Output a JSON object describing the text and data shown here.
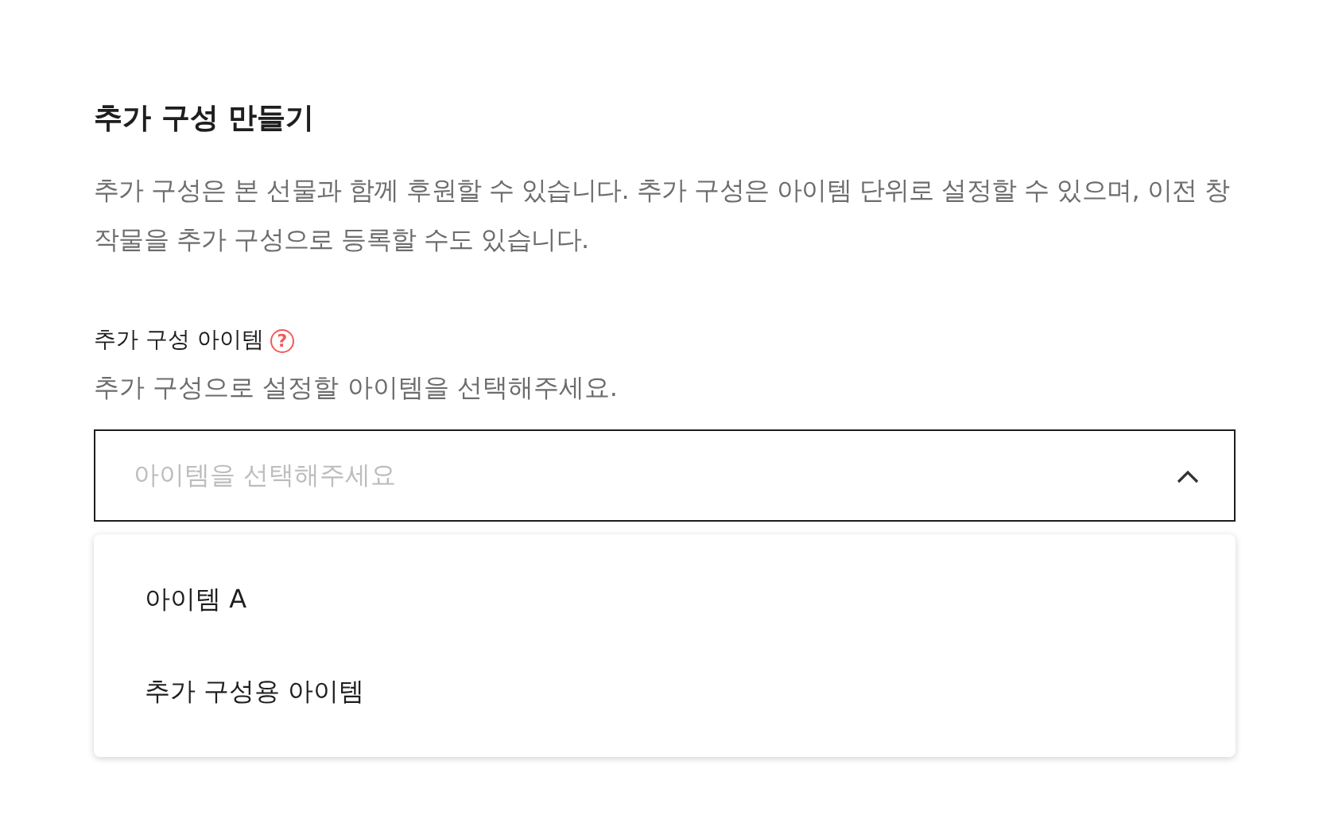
{
  "section": {
    "title": "추가 구성 만들기",
    "description": "추가 구성은 본 선물과 함께 후원할 수 있습니다. 추가 구성은 아이템 단위로 설정할 수 있으며, 이전 창작물을 추가 구성으로 등록할 수도 있습니다."
  },
  "field": {
    "label": "추가 구성 아이템",
    "help_icon": "?",
    "hint": "추가 구성으로 설정할 아이템을 선택해주세요.",
    "placeholder": "아이템을 선택해주세요",
    "expanded": true,
    "options": [
      {
        "label": "아이템 A"
      },
      {
        "label": "추가 구성용 아이템"
      }
    ]
  }
}
